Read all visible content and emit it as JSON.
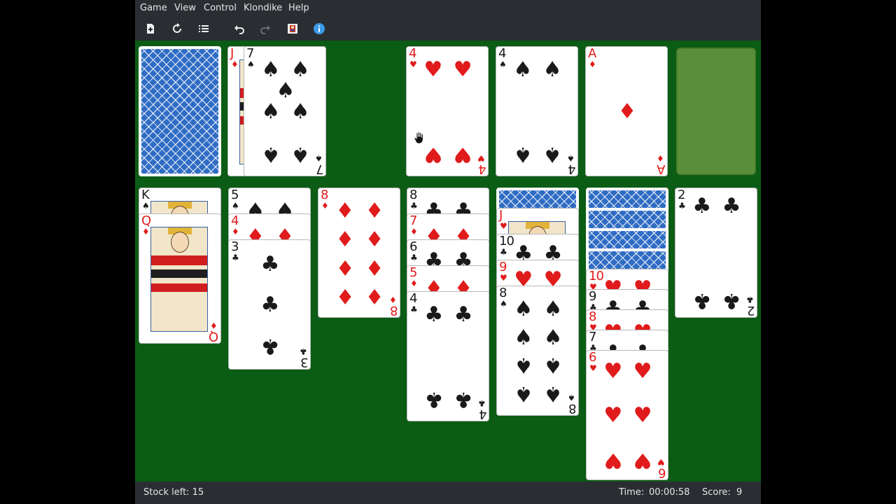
{
  "menubar": {
    "items": [
      "Game",
      "View",
      "Control",
      "Klondike",
      "Help"
    ]
  },
  "toolbar": {
    "tools": [
      "new-game-icon",
      "restart-icon",
      "list-icon",
      "undo-icon",
      "redo-icon",
      "deal-icon",
      "info-icon"
    ]
  },
  "colors": {
    "table": "#0b5c14",
    "red_suit": "#e01b1b",
    "black_suit": "#1a1a1a",
    "empty_slot": "#5a8f3a",
    "card_back": "#2f6cc4"
  },
  "waste": [
    {
      "rank": "J",
      "suit": "♦"
    },
    {
      "rank": "7",
      "suit": "♠"
    }
  ],
  "foundations": [
    {
      "rank": "4",
      "suit": "♥"
    },
    {
      "rank": "4",
      "suit": "♠"
    },
    {
      "rank": "A",
      "suit": "♦"
    }
  ],
  "tableau": [
    [
      {
        "rank": "K",
        "suit": "♠"
      },
      {
        "rank": "Q",
        "suit": "♦"
      }
    ],
    [
      {
        "rank": "5",
        "suit": "♠"
      },
      {
        "rank": "4",
        "suit": "♦"
      },
      {
        "rank": "3",
        "suit": "♣"
      }
    ],
    [
      {
        "rank": "8",
        "suit": "♦"
      }
    ],
    [
      {
        "rank": "8",
        "suit": "♣"
      },
      {
        "rank": "7",
        "suit": "♦"
      },
      {
        "rank": "6",
        "suit": "♣"
      },
      {
        "rank": "5",
        "suit": "♦"
      },
      {
        "rank": "4",
        "suit": "♣"
      }
    ],
    [
      {
        "rank": "J",
        "suit": "♥"
      },
      {
        "rank": "10",
        "suit": "♣"
      },
      {
        "rank": "9",
        "suit": "♥"
      },
      {
        "rank": "8",
        "suit": "♠"
      }
    ],
    [
      {
        "rank": "10",
        "suit": "♥"
      },
      {
        "rank": "9",
        "suit": "♣"
      },
      {
        "rank": "8",
        "suit": "♥"
      },
      {
        "rank": "7",
        "suit": "♣"
      },
      {
        "rank": "6",
        "suit": "♥"
      }
    ],
    [
      {
        "rank": "2",
        "suit": "♣"
      }
    ]
  ],
  "status": {
    "stock_left": "Stock left: 15",
    "time_label": "Time:",
    "time_value": "00:00:58",
    "score_label": "Score:",
    "score_value": "9"
  }
}
